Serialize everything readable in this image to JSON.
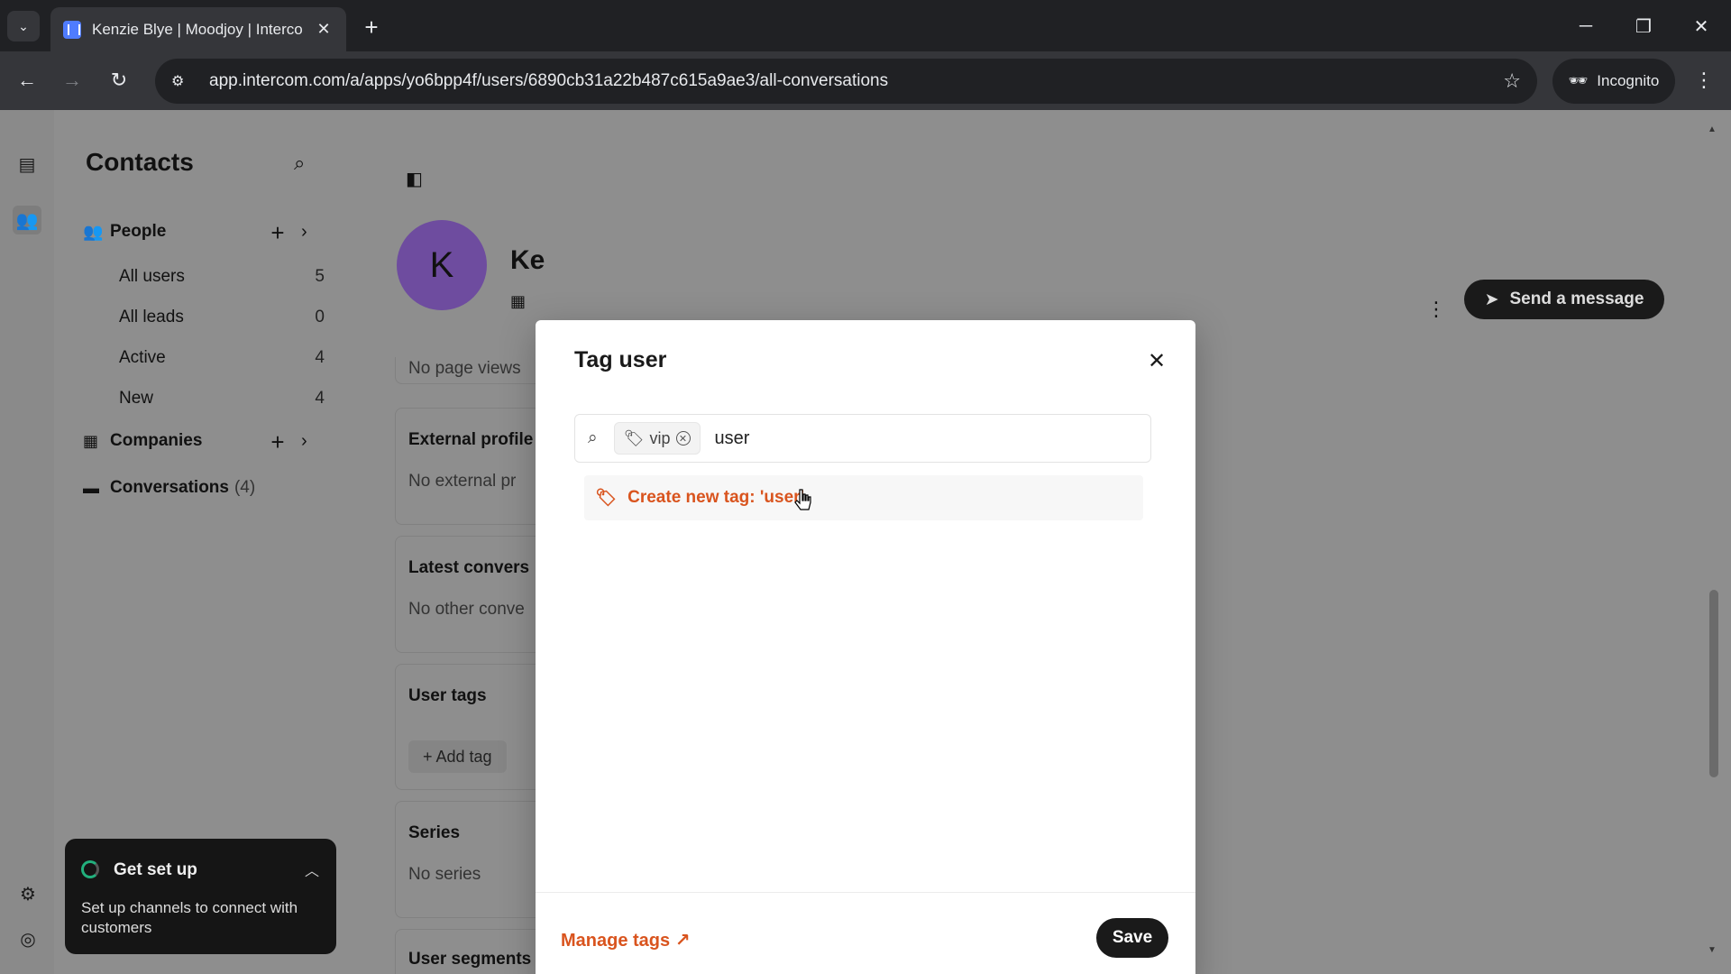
{
  "browser": {
    "tab_title": "Kenzie Blye | Moodjoy | Interco",
    "tab_close": "✕",
    "new_tab": "+",
    "url": "app.intercom.com/a/apps/yo6bpp4f/users/6890cb31a22b487c615a9ae3/all-conversations",
    "incognito_label": "Incognito"
  },
  "sidebar": {
    "title": "Contacts",
    "people_label": "People",
    "people_items": [
      {
        "label": "All users",
        "count": "5"
      },
      {
        "label": "All leads",
        "count": "0"
      },
      {
        "label": "Active",
        "count": "4"
      },
      {
        "label": "New",
        "count": "4"
      }
    ],
    "companies_label": "Companies",
    "conversations_label": "Conversations",
    "conversations_count": "(4)"
  },
  "get_set_up": {
    "title": "Get set up",
    "description": "Set up channels to connect with customers"
  },
  "profile": {
    "avatar_initial": "K",
    "name_visible": "Ke",
    "send_message_label": "Send a message",
    "cards": {
      "page_views_partial": "No page views",
      "external_profiles_title": "External profile",
      "external_profiles_sub": "No external pr",
      "latest_conversations_title": "Latest convers",
      "latest_conversations_sub": "No other conve",
      "user_tags_title": "User tags",
      "add_tag_label": "+ Add tag",
      "series_title": "Series",
      "series_sub": "No series",
      "user_segments_title": "User segments"
    }
  },
  "modal": {
    "title": "Tag user",
    "chip_label": "vip",
    "input_value": "user",
    "suggestion_label": "Create new tag: 'user'",
    "manage_tags_label": "Manage tags ↗",
    "save_label": "Save"
  },
  "colors": {
    "accent_orange": "#d9541e",
    "avatar_purple": "#6e4c9f",
    "dark_button": "#1a1a1a"
  }
}
